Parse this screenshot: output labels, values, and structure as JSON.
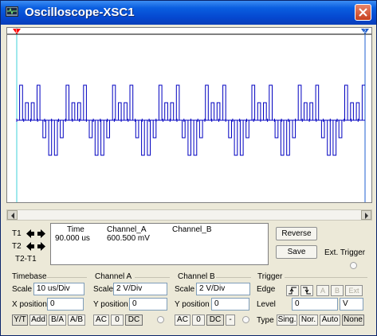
{
  "window": {
    "title": "Oscilloscope-XSC1",
    "title_color": "#0a5ee0"
  },
  "cursors": {
    "t1_label": "T1",
    "t2_label": "T2",
    "t2t1_label": "T2-T1"
  },
  "readout": {
    "headers": [
      "Time",
      "Channel_A",
      "Channel_B"
    ],
    "row1": {
      "time": "90.000 us",
      "channel_a": "600.500 mV",
      "channel_b": ""
    }
  },
  "buttons": {
    "reverse": "Reverse",
    "save": "Save",
    "ext_trigger": "Ext. Trigger"
  },
  "timebase": {
    "title": "Timebase",
    "scale_label": "Scale",
    "scale_value": "10 us/Div",
    "xpos_label": "X position",
    "xpos_value": "0",
    "modes": [
      "Y/T",
      "Add",
      "B/A",
      "A/B"
    ],
    "active_mode": "Y/T"
  },
  "channel_a": {
    "title": "Channel A",
    "scale_label": "Scale",
    "scale_value": "2  V/Div",
    "ypos_label": "Y position",
    "ypos_value": "0",
    "coupling": [
      "AC",
      "0",
      "DC"
    ],
    "active_coupling": "DC"
  },
  "channel_b": {
    "title": "Channel B",
    "scale_label": "Scale",
    "scale_value": "2  V/Div",
    "ypos_label": "Y position",
    "ypos_value": "0",
    "coupling": [
      "AC",
      "0",
      "DC",
      "-"
    ],
    "active_coupling": "DC"
  },
  "trigger": {
    "title": "Trigger",
    "edge_label": "Edge",
    "sources": [
      "A",
      "B",
      "Ext"
    ],
    "level_label": "Level",
    "level_value": "0",
    "level_unit": "V",
    "type_label": "Type",
    "types": [
      "Sing.",
      "Nor.",
      "Auto",
      "None"
    ],
    "active_type": "None"
  },
  "display": {
    "trace_color": "#0000c0",
    "cursor1_color": "#ff0000",
    "cursor2_color": "#1f5fd0",
    "trace_pattern": [
      0,
      2,
      0,
      1,
      0,
      1,
      0,
      2,
      0,
      -1,
      0,
      -2,
      0,
      -2,
      0,
      -1
    ],
    "trace_periods": 7.5
  }
}
